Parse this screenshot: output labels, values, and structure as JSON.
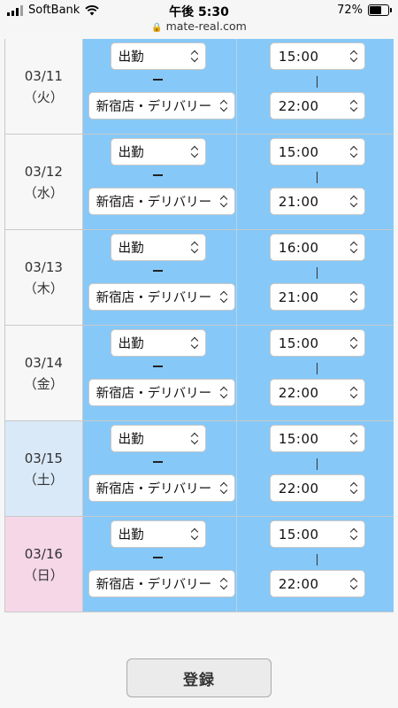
{
  "statusbar": {
    "carrier": "SoftBank",
    "time": "午後 5:30",
    "url": "mate-real.com",
    "battery": "72%",
    "battery_level": 0.72
  },
  "rows": [
    {
      "date": "03/11",
      "weekday": "（火）",
      "status": "出勤",
      "store": "新宿店・デリバリー",
      "start": "15:00",
      "end": "22:00",
      "day_type": "weekday"
    },
    {
      "date": "03/12",
      "weekday": "（水）",
      "status": "出勤",
      "store": "新宿店・デリバリー",
      "start": "15:00",
      "end": "21:00",
      "day_type": "weekday"
    },
    {
      "date": "03/13",
      "weekday": "（木）",
      "status": "出勤",
      "store": "新宿店・デリバリー",
      "start": "16:00",
      "end": "21:00",
      "day_type": "weekday"
    },
    {
      "date": "03/14",
      "weekday": "（金）",
      "status": "出勤",
      "store": "新宿店・デリバリー",
      "start": "15:00",
      "end": "22:00",
      "day_type": "weekday"
    },
    {
      "date": "03/15",
      "weekday": "（土）",
      "status": "出勤",
      "store": "新宿店・デリバリー",
      "start": "15:00",
      "end": "22:00",
      "day_type": "saturday"
    },
    {
      "date": "03/16",
      "weekday": "（日）",
      "status": "出勤",
      "store": "新宿店・デリバリー",
      "start": "15:00",
      "end": "22:00",
      "day_type": "sunday"
    }
  ],
  "colors": {
    "cell_blue": "#86c8f8",
    "saturday": "#d9e9f7",
    "sunday": "#f5d7e8"
  },
  "submit_label": "登録"
}
